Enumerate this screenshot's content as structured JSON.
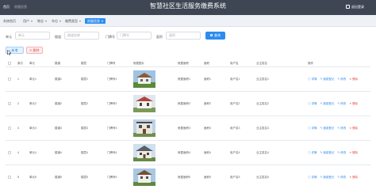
{
  "header": {
    "home": "首页",
    "breadcrumb": "房屋信息",
    "title": "智慧社区生活服务缴费系统",
    "logout": "退出登录"
  },
  "tabs": [
    {
      "label": "系统首页",
      "active": false
    },
    {
      "label": "用户",
      "active": false
    },
    {
      "label": "物业",
      "active": false
    },
    {
      "label": "车位",
      "active": false
    },
    {
      "label": "缴费类型",
      "active": false
    },
    {
      "label": "房屋信息",
      "active": true
    }
  ],
  "search": {
    "fields": [
      {
        "label": "单元",
        "placeholder": "单元"
      },
      {
        "label": "楼道",
        "placeholder": "楼道名称"
      },
      {
        "label": "门牌号",
        "placeholder": "门牌号"
      },
      {
        "label": "面积",
        "placeholder": "面积"
      }
    ],
    "button": "查询"
  },
  "actions": {
    "add": "新增",
    "delete": "删除"
  },
  "table": {
    "columns": [
      "索引",
      "单元",
      "楼道",
      "楼层",
      "门牌号",
      "房屋图片",
      "房屋面积",
      "面积",
      "用户名",
      "业主姓名",
      "操作"
    ],
    "rows": [
      {
        "index": "1",
        "unit": "单元1",
        "hall": "楼道1",
        "floor": "楼层1",
        "door": "门牌号1",
        "area_house": "房屋面积1",
        "area": "面积1",
        "user": "用户名1",
        "owner": "业主姓名1"
      },
      {
        "index": "2",
        "unit": "单元2",
        "hall": "楼道2",
        "floor": "楼层2",
        "door": "门牌号2",
        "area_house": "房屋面积2",
        "area": "面积2",
        "user": "用户名2",
        "owner": "业主姓名2"
      },
      {
        "index": "3",
        "unit": "单元3",
        "hall": "楼道3",
        "floor": "楼层3",
        "door": "门牌号3",
        "area_house": "房屋面积3",
        "area": "面积3",
        "user": "用户名3",
        "owner": "业主姓名3"
      },
      {
        "index": "4",
        "unit": "单元4",
        "hall": "楼道4",
        "floor": "楼层4",
        "door": "门牌号4",
        "area_house": "房屋面积4",
        "area": "面积4",
        "user": "用户名4",
        "owner": "业主姓名4"
      },
      {
        "index": "5",
        "unit": "单元5",
        "hall": "楼道5",
        "floor": "楼层5",
        "door": "门牌号5",
        "area_house": "房屋面积5",
        "area": "面积5",
        "user": "用户名5",
        "owner": "业主姓名5"
      }
    ],
    "ops": {
      "detail": "详情",
      "pay": "缴费登记",
      "edit": "修改",
      "delete": "删除"
    }
  },
  "colors": {
    "primary": "#2d8cf0",
    "danger": "#e64b4b",
    "header_bg": "#3f4653"
  }
}
